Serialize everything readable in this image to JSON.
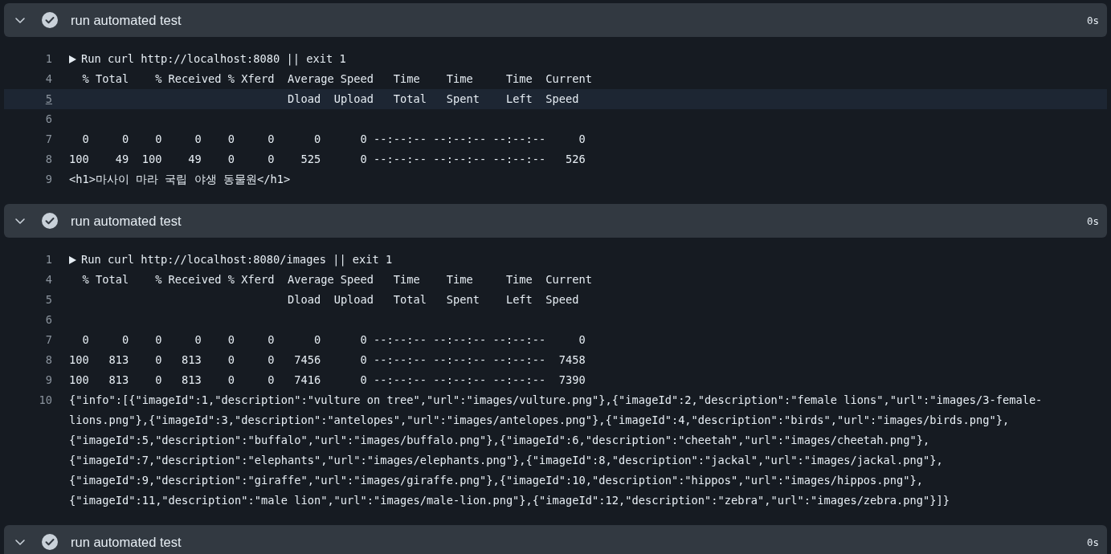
{
  "steps": [
    {
      "title": "run automated test",
      "duration": "0s",
      "lines": [
        {
          "number": "1",
          "kind": "group",
          "text": "Run curl http://localhost:8080 || exit 1",
          "selected": false
        },
        {
          "number": "4",
          "kind": "plain",
          "text": "  % Total    % Received % Xferd  Average Speed   Time    Time     Time  Current",
          "selected": false
        },
        {
          "number": "5",
          "kind": "plain",
          "text": "                                 Dload  Upload   Total   Spent    Left  Speed",
          "selected": true
        },
        {
          "number": "6",
          "kind": "plain",
          "selected": false
        },
        {
          "number": "7",
          "kind": "plain",
          "text": "  0     0    0     0    0     0      0      0 --:--:-- --:--:-- --:--:--     0",
          "selected": false
        },
        {
          "number": "8",
          "kind": "plain",
          "text": "100    49  100    49    0     0    525      0 --:--:-- --:--:-- --:--:--   526",
          "selected": false
        },
        {
          "number": "9",
          "kind": "plain",
          "text": "<h1>마사이 마라 국립 야생 동물원</h1>",
          "selected": false
        }
      ]
    },
    {
      "title": "run automated test",
      "duration": "0s",
      "lines": [
        {
          "number": "1",
          "kind": "group",
          "text": "Run curl http://localhost:8080/images || exit 1",
          "selected": false
        },
        {
          "number": "4",
          "kind": "plain",
          "text": "  % Total    % Received % Xferd  Average Speed   Time    Time     Time  Current",
          "selected": false
        },
        {
          "number": "5",
          "kind": "plain",
          "text": "                                 Dload  Upload   Total   Spent    Left  Speed",
          "selected": false
        },
        {
          "number": "6",
          "kind": "plain",
          "selected": false
        },
        {
          "number": "7",
          "kind": "plain",
          "text": "  0     0    0     0    0     0      0      0 --:--:-- --:--:-- --:--:--     0",
          "selected": false
        },
        {
          "number": "8",
          "kind": "plain",
          "text": "100   813    0   813    0     0   7456      0 --:--:-- --:--:-- --:--:--  7458",
          "selected": false
        },
        {
          "number": "9",
          "kind": "plain",
          "text": "100   813    0   813    0     0   7416      0 --:--:-- --:--:-- --:--:--  7390",
          "selected": false
        },
        {
          "number": "10",
          "kind": "plain",
          "text": "{\"info\":[{\"imageId\":1,\"description\":\"vulture on tree\",\"url\":\"images/vulture.png\"},{\"imageId\":2,\"description\":\"female lions\",\"url\":\"images/3-female-lions.png\"},{\"imageId\":3,\"description\":\"antelopes\",\"url\":\"images/antelopes.png\"},{\"imageId\":4,\"description\":\"birds\",\"url\":\"images/birds.png\"},{\"imageId\":5,\"description\":\"buffalo\",\"url\":\"images/buffalo.png\"},{\"imageId\":6,\"description\":\"cheetah\",\"url\":\"images/cheetah.png\"},{\"imageId\":7,\"description\":\"elephants\",\"url\":\"images/elephants.png\"},{\"imageId\":8,\"description\":\"jackal\",\"url\":\"images/jackal.png\"},{\"imageId\":9,\"description\":\"giraffe\",\"url\":\"images/giraffe.png\"},{\"imageId\":10,\"description\":\"hippos\",\"url\":\"images/hippos.png\"},{\"imageId\":11,\"description\":\"male lion\",\"url\":\"images/male-lion.png\"},{\"imageId\":12,\"description\":\"zebra\",\"url\":\"images/zebra.png\"}]}",
          "selected": false
        }
      ]
    },
    {
      "title": "run automated test",
      "duration": "0s"
    }
  ]
}
